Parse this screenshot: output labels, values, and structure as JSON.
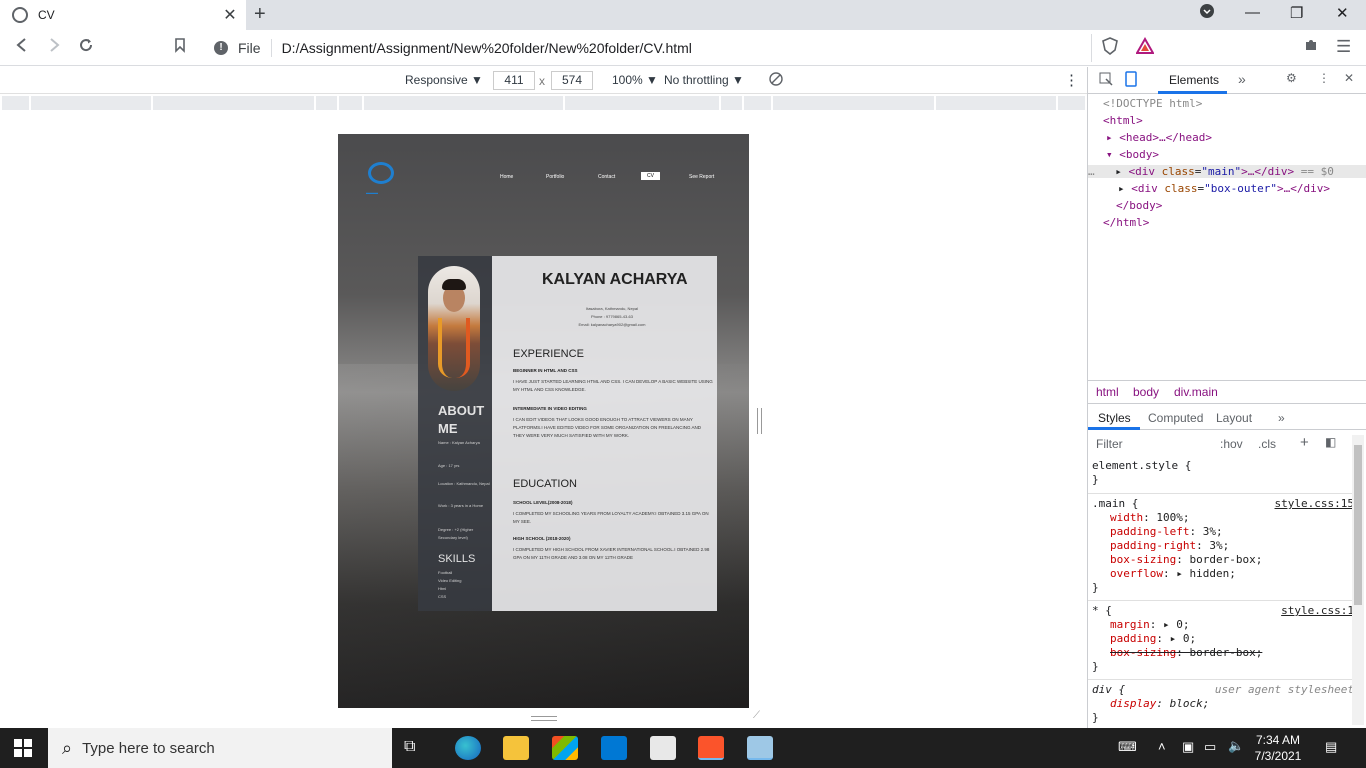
{
  "browser": {
    "tab_title": "CV",
    "tab_close": "✕",
    "new_tab": "+",
    "file_label": "File",
    "url": "D:/Assignment/Assignment/New%20folder/New%20folder/CV.html"
  },
  "device_toolbar": {
    "mode": "Responsive",
    "width": "411",
    "times": "x",
    "height": "574",
    "zoom": "100%",
    "throttling": "No throttling"
  },
  "cv_page": {
    "nav": [
      "Home",
      "Portfolio",
      "Contact",
      "CV",
      "See Report"
    ],
    "active_nav": "CV",
    "name": "KALYAN ACHARYA",
    "contact_lines": [
      "Itasabora, Kathmandu, Nepal",
      "Phone : 9779865-43-63",
      "Email: kalyanacharya902@gmail.com"
    ],
    "about_heading": "ABOUT ME",
    "about_items": [
      "Name : Kalyan Acharya",
      "Age : 17 yrs",
      "Location : Kathmandu, Nepal",
      "Work : 3 years in a Home",
      "Degree : +2 (Higher Secondary level)"
    ],
    "skills_heading": "SKILLS",
    "skills": [
      "Football",
      "Video Editing",
      "Html",
      "CSS"
    ],
    "experience_heading": "EXPERIENCE",
    "experience": [
      {
        "title": "BEGINNER IN HTML AND CSS",
        "text": "I HAVE JUST STARTED LEARNING HTML AND CSS. I CAN DEVELOP A BASIC WEBSITE USING MY HTML AND CSS KNOWLEDGE."
      },
      {
        "title": "INTERMEDIATE IN VIDEO EDITING",
        "text": "I CAN EDIT VIDEOS THAT LOOKS GOOD ENOUGH TO ATTRACT VIEWERS ON MANY PLATFORMS.I HAVE EDITED VIDEO FOR SOME ORGANIZATION ON FREELANCING AND THEY WERE VERY MUCH SATISFIED WITH MY WORK."
      }
    ],
    "education_heading": "EDUCATION",
    "education": [
      {
        "title": "SCHOOL LEVEL(2008-2018)",
        "text": "I COMPLETED MY SCHOOLING YEARS FROM LOYALTY ACADEMY.I OBTAINED 3.15 GPA ON MY SEE."
      },
      {
        "title": "HIGH SCHOOL (2018-2020)",
        "text": "I COMPLETED MY HIGH SCHOOL FROM XAVIER INTERNATIONAL SCHOOL.I OBTAINED 2.98 GPA ON MY 11TH GRADE AND 3.08 ON MY 12TH GRADE"
      }
    ]
  },
  "devtools": {
    "tab_elements": "Elements",
    "more_tabs": "»",
    "dom": {
      "doctype": "<!DOCTYPE html>",
      "html_open": "<html>",
      "head": "<head>…</head>",
      "body_open": "<body>",
      "div_main_tag": "<div",
      "class_attr": "class",
      "main_val": "\"main\"",
      "div_close": ">…</div>",
      "eq0": "== $0",
      "box_outer_val": "\"box-outer\"",
      "body_close": "</body>",
      "html_close": "</html>",
      "ellipsis": "…"
    },
    "breadcrumbs": [
      "html",
      "body",
      "div.main"
    ],
    "styles_tabs": [
      "Styles",
      "Computed",
      "Layout",
      "»"
    ],
    "filter_placeholder": "Filter",
    "hov": ":hov",
    "cls": ".cls",
    "rules": {
      "element_style": "element.style {",
      "close": "}",
      "main_selector": ".main {",
      "main_src": "style.css:15",
      "main_props": [
        {
          "name": "width",
          "value": "100%;"
        },
        {
          "name": "padding-left",
          "value": "3%;"
        },
        {
          "name": "padding-right",
          "value": "3%;"
        },
        {
          "name": "box-sizing",
          "value": "border-box;"
        },
        {
          "name": "overflow",
          "value": "▸ hidden;"
        }
      ],
      "star_selector": "* {",
      "star_src": "style.css:1",
      "star_props": [
        {
          "name": "margin",
          "value": "▸ 0;"
        },
        {
          "name": "padding",
          "value": "▸ 0;"
        },
        {
          "name": "box-sizing",
          "value": "border-box;"
        }
      ],
      "div_selector": "div {",
      "div_src": "user agent stylesheet",
      "div_props": [
        {
          "name": "display",
          "value": "block;"
        }
      ]
    }
  },
  "taskbar": {
    "search_placeholder": "Type here to search",
    "time": "7:34 AM",
    "date": "7/3/2021"
  }
}
